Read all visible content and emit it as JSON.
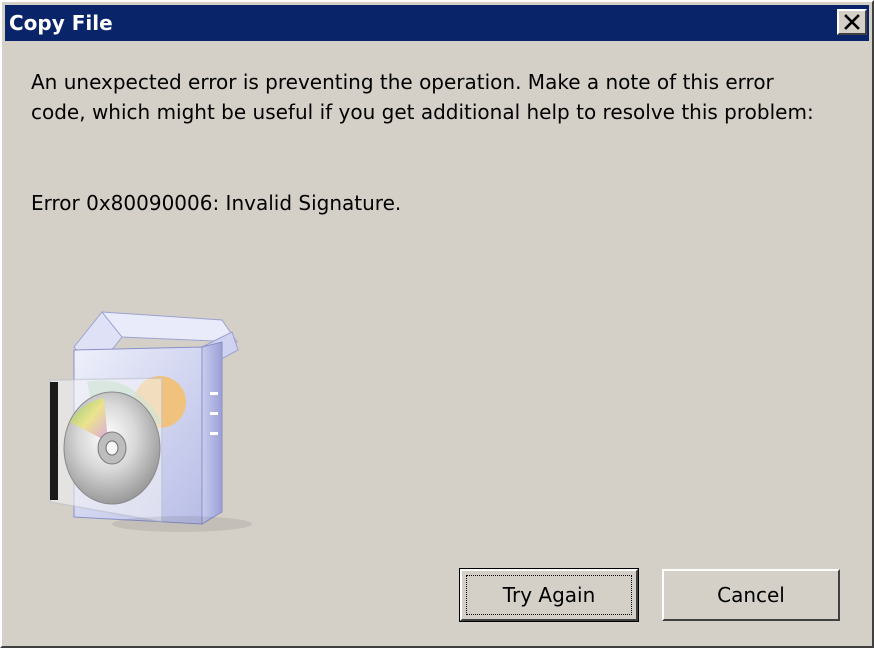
{
  "window": {
    "title": "Copy File",
    "title_bar_color": "#0a246a",
    "background_color": "#d4d0c8"
  },
  "titlebar": {
    "close_icon": "close-icon"
  },
  "dialog": {
    "message": "An unexpected error is preventing the operation. Make a note of this error code, which might be useful if you get additional help to resolve this problem:",
    "error": "Error 0x80090006: Invalid Signature.",
    "illustration_icon": "software-box-cd-icon"
  },
  "buttons": {
    "try_again": "Try Again",
    "cancel": "Cancel"
  }
}
